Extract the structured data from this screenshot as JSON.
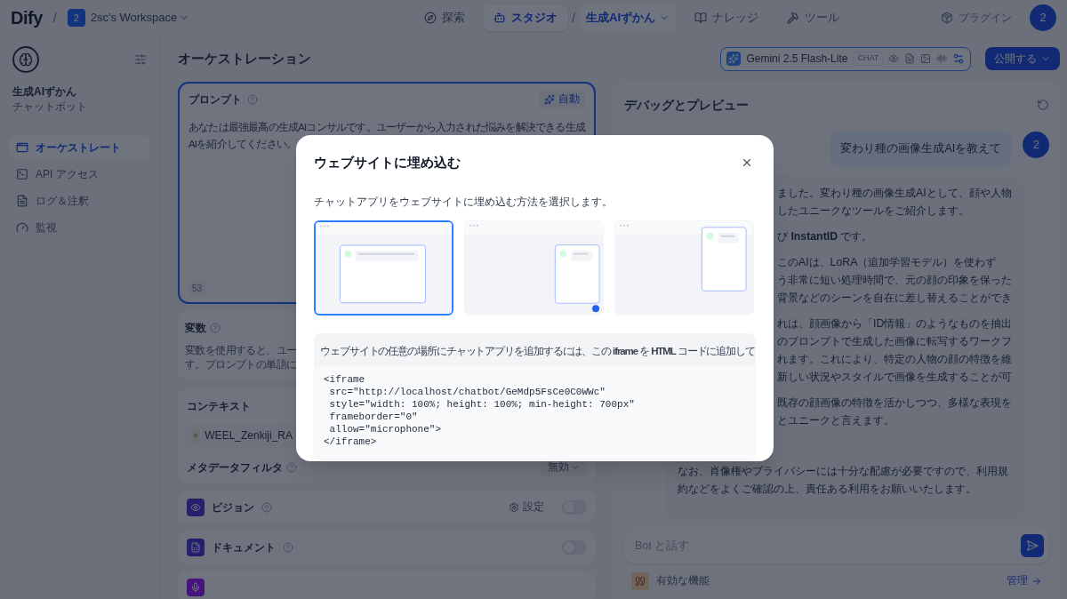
{
  "top_nav": {
    "logo": "Dify",
    "separator": "/",
    "workspace_badge": "2",
    "workspace": "2sc's Workspace",
    "items": [
      {
        "label": "探索",
        "selected": false
      },
      {
        "label": "スタジオ",
        "selected": true,
        "app_separator": "/",
        "app_switcher": "生成AIずかん"
      },
      {
        "label": "ナレッジ",
        "selected": false
      },
      {
        "label": "ツール",
        "selected": false
      }
    ],
    "plugins": "プラグイン",
    "avatar": "2"
  },
  "sidebar": {
    "app_name": "生成AIずかん",
    "app_type": "チャットボット",
    "items": [
      {
        "label": "オーケストレート",
        "selected": true
      },
      {
        "label": "API アクセス",
        "selected": false
      },
      {
        "label": "ログ＆注釈",
        "selected": false
      },
      {
        "label": "監視",
        "selected": false
      }
    ]
  },
  "header": {
    "title": "オーケストレーション",
    "model": "Gemini 2.5 Flash-Lite",
    "model_badge": "CHAT",
    "publish_button": "公開する"
  },
  "prompt": {
    "title": "プロンプト",
    "auto_button": "自動",
    "text": "あなたは最強最高の生成AIコンサルです。ユーザーから入力された悩みを解決できる生成AIを紹介してください。",
    "count": "53"
  },
  "variables": {
    "title": "変数",
    "description_lines": [
      "変数を使用すると、ユー",
      "す。プロンプトの単語に"
    ]
  },
  "context": {
    "title": "コンテキスト",
    "dataset": "WEEL_Zenkiji_RA",
    "metadata_filter": "メタデータフィルタ",
    "filter_value": "無効"
  },
  "features": [
    {
      "kind": "vision",
      "label": "ビジョン",
      "settings": "設定",
      "on": false
    },
    {
      "kind": "document",
      "label": "ドキュメント",
      "on": false
    },
    {
      "kind": "cut"
    }
  ],
  "debug": {
    "title": "デバッグとプレビュー",
    "user_message": "変わり種の画像生成AIを教えて",
    "user_avatar": "2",
    "answer": [
      [
        "ました。変わり種の画像生成AIとして、顔や人物",
        "したユニークなツールをご紹介します。"
      ],
      [
        "び **InstantID** です。"
      ],
      [
        "このAIは、LoRA（追加学習モデル）を使わず",
        "う非常に短い処理時間で、元の顔の印象を保った",
        "背景などのシーンを自在に差し替えることができ"
      ],
      [
        "れは、顔画像から「ID情報」のようなものを抽出",
        "のプロンプトで生成した画像に転写するワークフ",
        "れます。これにより、特定の人物の顔の特徴を維",
        "新しい状況やスタイルで画像を生成することが可"
      ],
      [
        "既存の顔画像の特徴を活かしつつ、多様な表現を",
        "とユニークと言えます。"
      ]
    ],
    "closing": "なお、肖像権やプライバシーには十分な配慮が必要ですので、利用規約などをよくご確認の上、責任ある利用をお願いいたします。",
    "input_placeholder": "Bot と話す",
    "features_label": "有効な機能",
    "manage_link": "管理"
  },
  "modal": {
    "title": "ウェブサイトに埋め込む",
    "description": "チャットアプリをウェブサイトに埋め込む方法を選択します。",
    "options": [
      {
        "kind": "fullscreen",
        "selected": true
      },
      {
        "kind": "bubble",
        "selected": false
      },
      {
        "kind": "side",
        "selected": false
      }
    ],
    "code_caption": "ウェブサイトの任意の場所にチャットアプリを追加するには、この **iframe** を **HTML** コードに追加して",
    "code": "<iframe\n src=\"http://localhost/chatbot/GeMdp5FsCe0C0WWc\"\n style=\"width: 100%; height: 100%; min-height: 700px\"\n frameborder=\"0\"\n allow=\"microphone\">\n</iframe>"
  }
}
